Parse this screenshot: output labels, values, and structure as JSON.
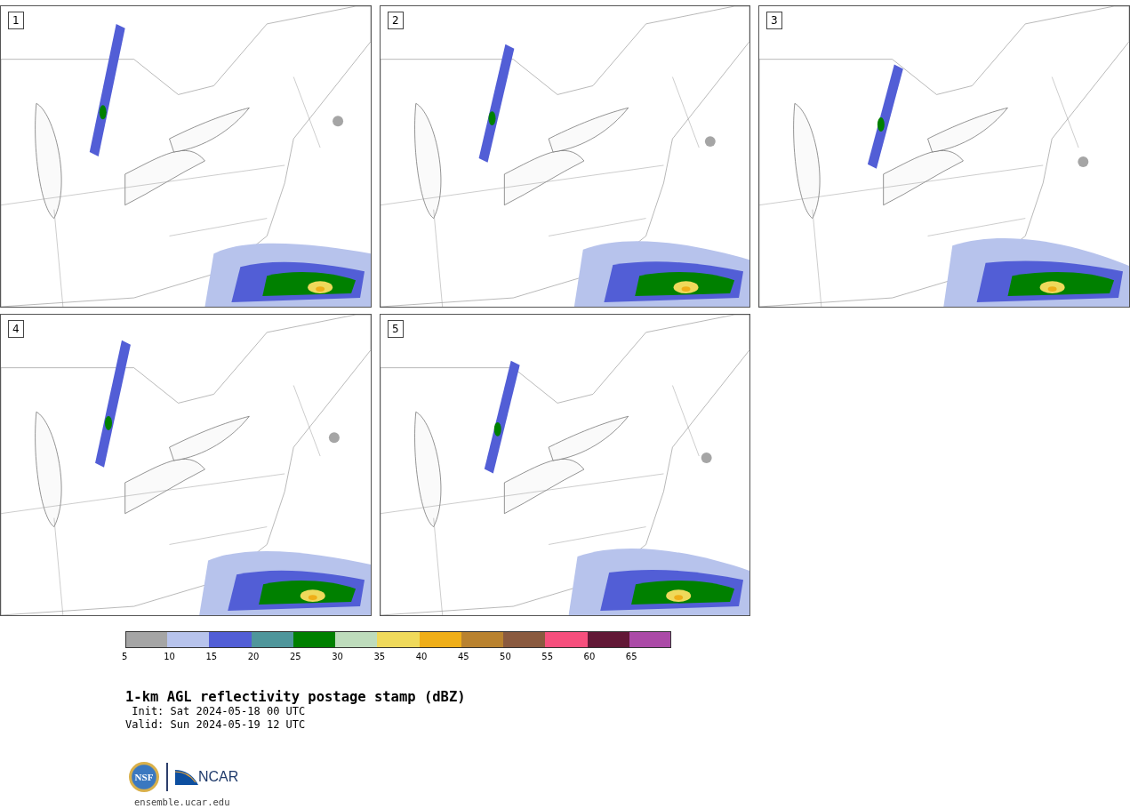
{
  "panels": [
    {
      "label": "1"
    },
    {
      "label": "2"
    },
    {
      "label": "3"
    },
    {
      "label": "4"
    },
    {
      "label": "5"
    }
  ],
  "colorbar": {
    "bins": [
      {
        "label": "5",
        "color": "#a5a5a5"
      },
      {
        "label": "10",
        "color": "#b7c3ec"
      },
      {
        "label": "15",
        "color": "#525ed6"
      },
      {
        "label": "20",
        "color": "#4f969b"
      },
      {
        "label": "25",
        "color": "#008000"
      },
      {
        "label": "30",
        "color": "#bedcbc"
      },
      {
        "label": "35",
        "color": "#efd95b"
      },
      {
        "label": "40",
        "color": "#efae18"
      },
      {
        "label": "45",
        "color": "#b9822f"
      },
      {
        "label": "50",
        "color": "#8a5a3f"
      },
      {
        "label": "55",
        "color": "#f64f7d"
      },
      {
        "label": "60",
        "color": "#621836"
      },
      {
        "label": "65",
        "color": "#ab4aa7"
      }
    ]
  },
  "title": "1-km AGL reflectivity postage stamp (dBZ)",
  "init": " Init: Sat 2024-05-18 00 UTC",
  "valid": "Valid: Sun 2024-05-19 12 UTC",
  "logo": {
    "left": "NSF",
    "right": "NCAR"
  },
  "url": "ensemble.ucar.edu"
}
